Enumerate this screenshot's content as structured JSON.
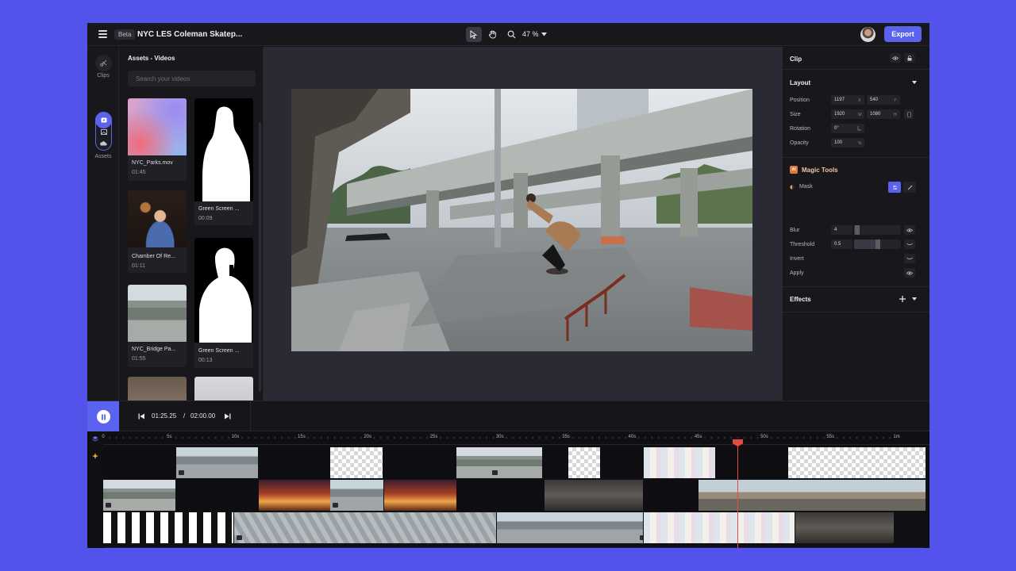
{
  "topbar": {
    "beta_label": "Beta",
    "project_title": "NYC LES Coleman Skatep...",
    "zoom": "47 %",
    "export_label": "Export",
    "tools": [
      "select-tool",
      "hand-tool",
      "zoom-tool"
    ]
  },
  "rail": {
    "items": [
      {
        "label": "Clips",
        "icon": "scissors-icon"
      },
      {
        "label": "Assets",
        "icon": "video-icon"
      }
    ]
  },
  "assets": {
    "title": "Assets - Videos",
    "search_placeholder": "Search your videos",
    "items": [
      {
        "name": "NYC_Parks.mov",
        "duration": "01:45"
      },
      {
        "name": "Green Screen ...",
        "duration": "00:09"
      },
      {
        "name": "Chamber Of Re...",
        "duration": "01:11"
      },
      {
        "name": "Green Screen ...",
        "duration": "00:13"
      },
      {
        "name": "NYC_Bridge Pa...",
        "duration": "01:55"
      }
    ]
  },
  "inspector": {
    "clip_title": "Clip",
    "layout_title": "Layout",
    "position_label": "Position",
    "position_x": "1197",
    "position_y": "540",
    "size_label": "Size",
    "size_w": "1920",
    "size_h": "1080",
    "rotation_label": "Rotation",
    "rotation_value": "0°",
    "opacity_label": "Opacity",
    "opacity_value": "100",
    "unit_x": "X",
    "unit_y": "Y",
    "unit_w": "W",
    "unit_h": "H",
    "unit_pct": "%",
    "magic_badge": "AI",
    "magic_title": "Magic Tools",
    "mask_label": "Mask",
    "blur_label": "Blur",
    "blur_value": "4",
    "blur_level": 0.07,
    "threshold_label": "Threshold",
    "threshold_value": "0.5",
    "threshold_level": 0.5,
    "invert_label": "Invert",
    "apply_label": "Apply",
    "effects_title": "Effects"
  },
  "transport": {
    "current_time": "01:25.25",
    "separator": "/",
    "total_time": "02:00.00"
  },
  "timeline": {
    "ticks": [
      "0",
      "5s",
      "10s",
      "15s",
      "20s",
      "25s",
      "30s",
      "35s",
      "40s",
      "45s",
      "50s",
      "55s",
      "1m"
    ],
    "playhead_time": "48s"
  },
  "colors": {
    "accent": "#5a62ee",
    "background": "#5353ec",
    "playhead": "#e24b3f"
  }
}
